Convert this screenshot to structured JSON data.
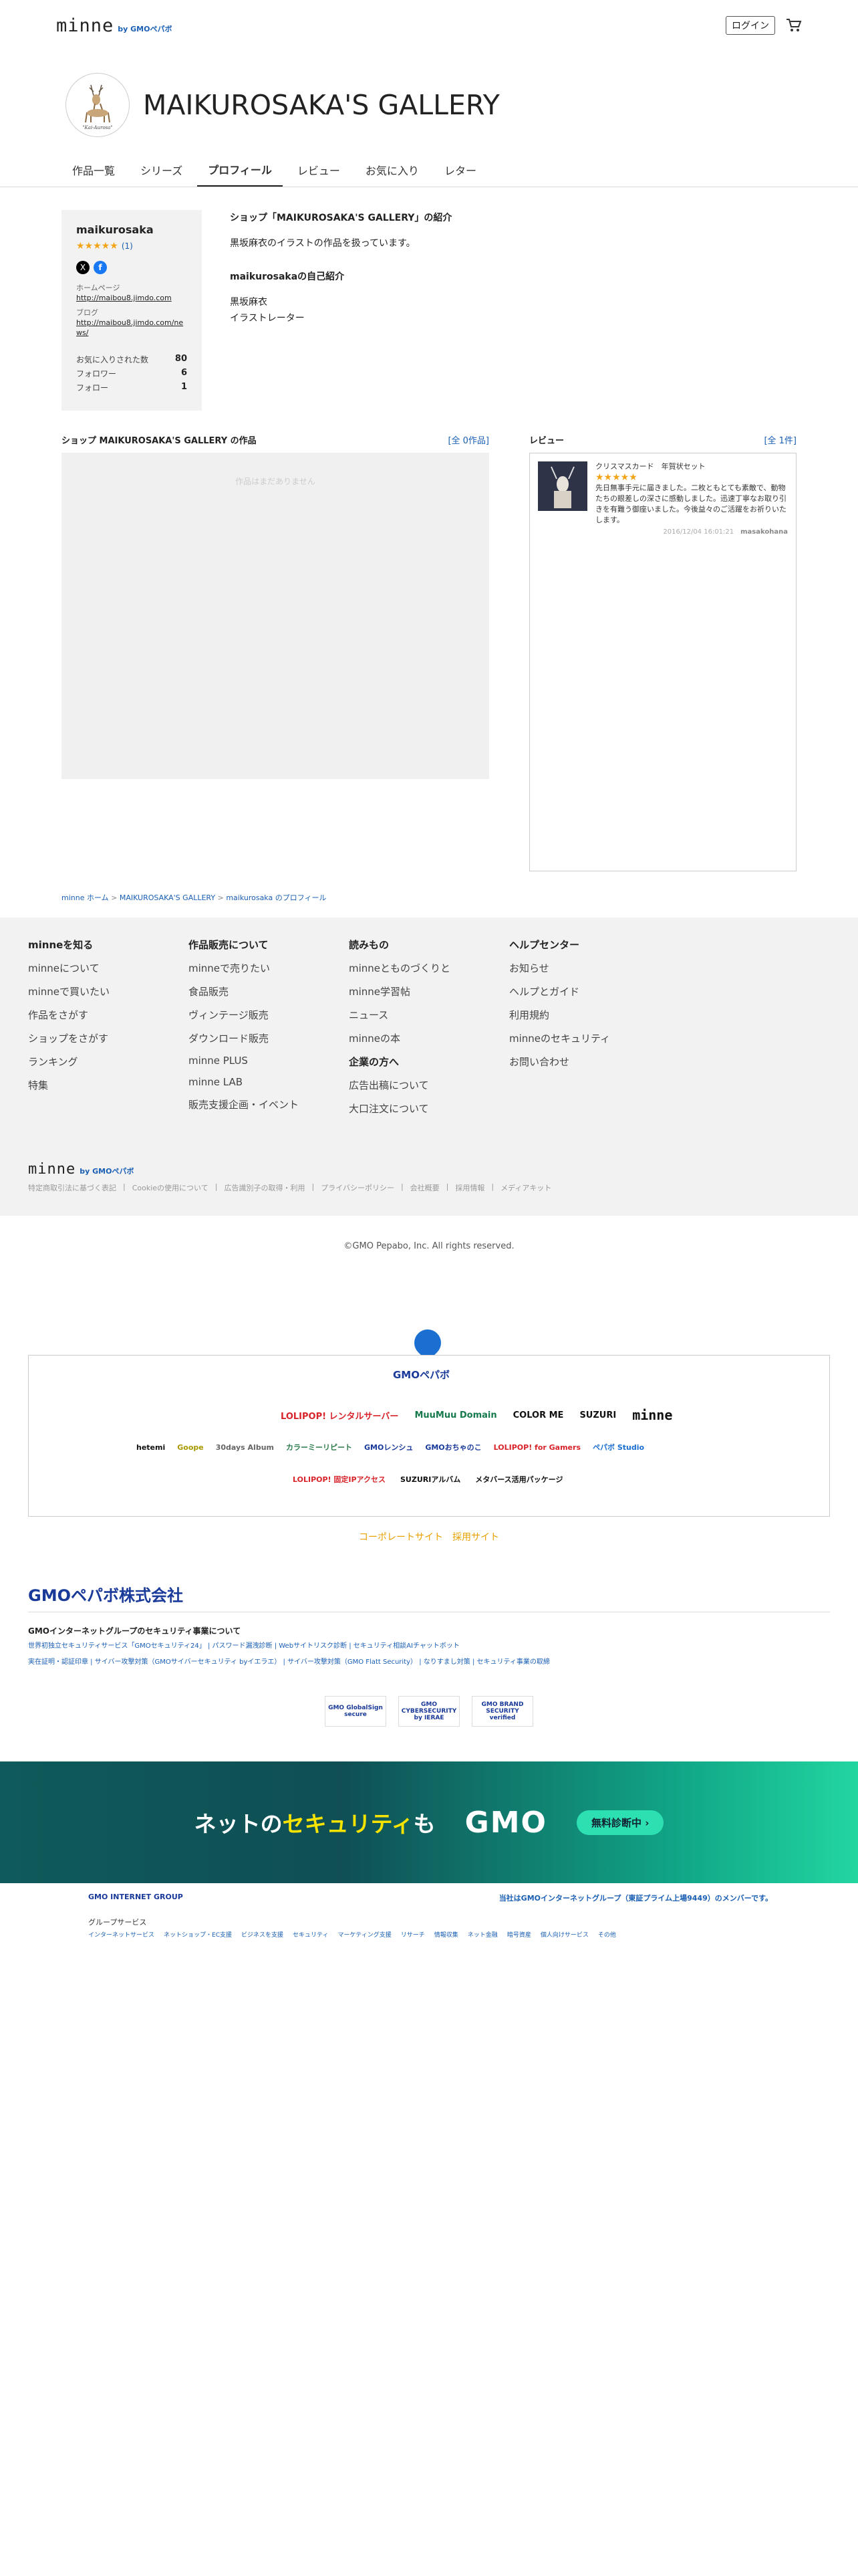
{
  "header": {
    "logo": "minne",
    "logo_sub": "by GMOペパボ",
    "login": "ログイン"
  },
  "shop": {
    "title": "MAIKUROSAKA'S GALLERY",
    "avatar_caption": "\"Kai-Aurosa\""
  },
  "tabs": [
    "作品一覧",
    "シリーズ",
    "プロフィール",
    "レビュー",
    "お気に入り",
    "レター"
  ],
  "profile": {
    "name": "maikurosaka",
    "stars": "★★★★★",
    "review_count": "(1)",
    "homepage_label": "ホームページ",
    "homepage": "http://maibou8.jimdo.com",
    "blog_label": "ブログ",
    "blog": "http://maibou8.jimdo.com/news/",
    "stats": [
      {
        "label": "お気に入りされた数",
        "value": "80"
      },
      {
        "label": "フォロワー",
        "value": "6"
      },
      {
        "label": "フォロー",
        "value": "1"
      }
    ]
  },
  "intro": {
    "shop_heading": "ショップ「MAIKUROSAKA'S GALLERY」の紹介",
    "shop_text": "黒坂麻衣のイラストの作品を扱っています。",
    "self_heading": "maikurosakaの自己紹介",
    "self_lines": [
      "黒坂麻衣",
      "イラストレーター"
    ]
  },
  "works": {
    "heading": "ショップ MAIKUROSAKA'S GALLERY の作品",
    "all": "[全 0作品]",
    "empty": "作品はまだありません"
  },
  "reviews": {
    "heading": "レビュー",
    "all": "[全 1件]",
    "item": {
      "title": "クリスマスカード　年賀状セット",
      "stars": "★★★★★",
      "text": "先日無事手元に届きました。二枚ともとても素敵で、動物たちの眼差しの深さに感動しました。迅速丁寧なお取り引きを有難う御座いました。今後益々のご活躍をお祈りいたします。",
      "date": "2016/12/04 16:01:21",
      "user": "masakohana"
    }
  },
  "breadcrumb": [
    "minne ホーム",
    ">",
    "MAIKUROSAKA'S GALLERY",
    ">",
    "maikurosaka のプロフィール"
  ],
  "footer": {
    "cols": [
      {
        "title": "minneを知る",
        "items": [
          "minneについて",
          "minneで買いたい",
          "作品をさがす",
          "ショップをさがす",
          "ランキング",
          "特集"
        ]
      },
      {
        "title": "作品販売について",
        "items": [
          "minneで売りたい",
          "食品販売",
          "ヴィンテージ販売",
          "ダウンロード販売",
          "minne PLUS",
          "minne LAB",
          "販売支援企画・イベント"
        ]
      },
      {
        "title": "読みもの",
        "items": [
          "minneとものづくりと",
          "minne学習帖",
          "ニュース",
          "minneの本"
        ],
        "title2": "企業の方へ",
        "items2": [
          "広告出稿について",
          "大口注文について"
        ]
      },
      {
        "title": "ヘルプセンター",
        "items": [
          "お知らせ",
          "ヘルプとガイド",
          "利用規約",
          "minneのセキュリティ",
          "お問い合わせ"
        ]
      }
    ],
    "bottom_links": [
      "特定商取引法に基づく表記",
      "Cookieの使用について",
      "広告識別子の取得・利用",
      "プライバシーポリシー",
      "会社概要",
      "採用情報",
      "メディアキット"
    ]
  },
  "copyright": "©GMO Pepabo, Inc. All rights reserved.",
  "gmo": {
    "logo": "GMOペパボ",
    "brands_row1": [
      "LOLIPOP! レンタルサーバー",
      "MuuMuu Domain",
      "COLOR ME",
      "SUZURI",
      "minne"
    ],
    "brands_row2": [
      "hetemi",
      "Goope",
      "30days Album",
      "カラーミーリピート",
      "GMOレンシュ",
      "GMOおちゃのこ",
      "LOLIPOP! for Gamers",
      "ペパボ Studio"
    ],
    "brands_row3": [
      "LOLIPOP! 固定IPアクセス",
      "SUZURIアルバム",
      "メタバース活用パッケージ"
    ],
    "corp_links": "コーポレートサイト　採用サイト",
    "corp": "GMOペパボ株式会社",
    "security_title": "GMOインターネットグループのセキュリティ事業について",
    "security_links1": [
      "世界初独立セキュリティサービス「GMOセキュリティ24」",
      "パスワード漏洩診断",
      "Webサイトリスク診断",
      "セキュリティ相談AIチャットボット"
    ],
    "security_links2": [
      "実在証明・認証印章",
      "サイバー攻撃対策（GMOサイバーセキュリティ byイエラエ）",
      "サイバー攻撃対策（GMO Flatt Security）",
      "なりすまし対策",
      "セキュリティ事業の取締"
    ],
    "badges": [
      "GMO GlobalSign secure",
      "GMO CYBERSECURITY by IERAE",
      "GMO BRAND SECURITY verified"
    ],
    "banner_pre": "ネットの",
    "banner_hl": "セキュリティ",
    "banner_post": "も",
    "banner_gmo": "GMO",
    "banner_btn": "無料診断中 ›",
    "group": "GMO INTERNET GROUP",
    "member": "当社はGMOインターネットグループ（東証プライム上場9449）のメンバーです。",
    "services_title": "グループサービス",
    "services": [
      "インターネットサービス",
      "ネットショップ・EC支援",
      "ビジネスを支援",
      "セキュリティ",
      "マーケティング支援",
      "リサーチ",
      "情報収集",
      "ネット金融",
      "暗号資産",
      "個人向けサービス",
      "その他"
    ]
  }
}
